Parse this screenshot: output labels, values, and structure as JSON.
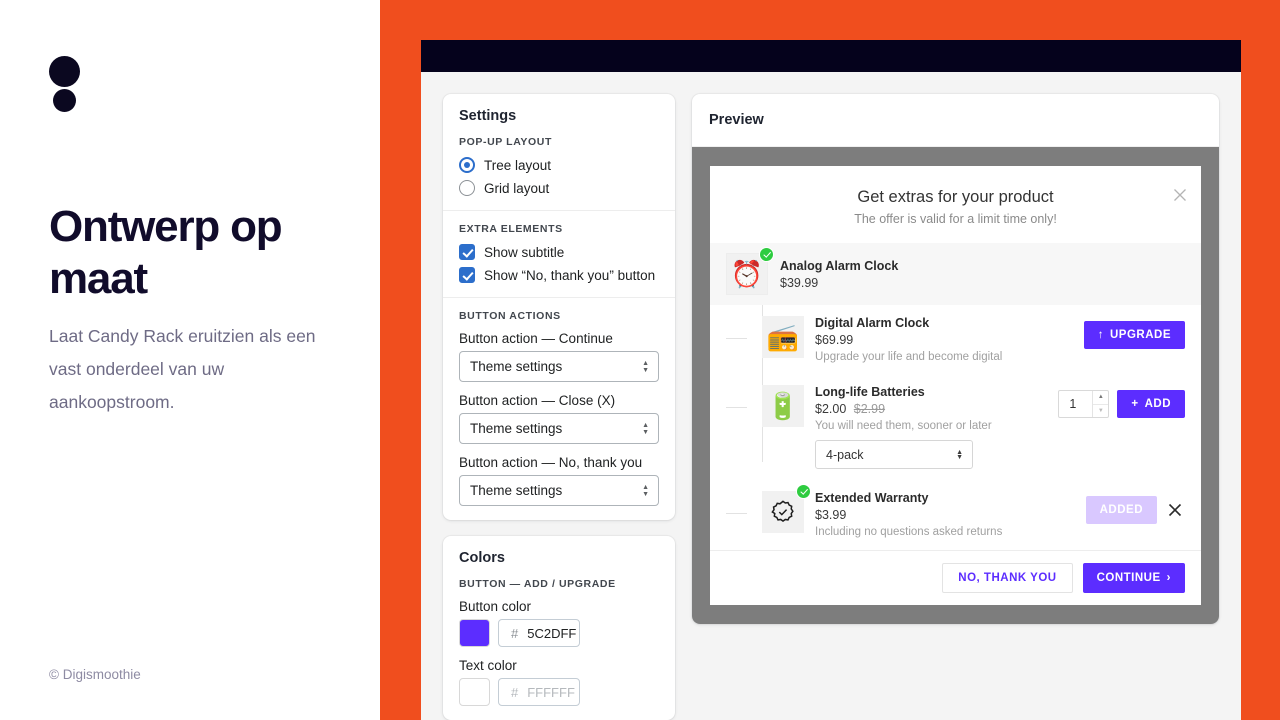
{
  "promo": {
    "logo_icon": "two-dots-logo",
    "title": "Ontwerp op maat",
    "subtitle": "Laat Candy Rack eruitzien als een vast onderdeel van uw aankoopstroom.",
    "copyright": "© Digismoothie"
  },
  "theme": {
    "accent_orange": "#F04E1E",
    "topbar_dark": "#05021C",
    "shopify_blue": "#2C6ECB",
    "brand_purple": "#5C2DFF",
    "added_purple": "#D9C8FF",
    "badge_green": "#2ECC40"
  },
  "settings": {
    "title": "Settings",
    "popup_layout": {
      "label": "POP-UP LAYOUT",
      "options": [
        {
          "label": "Tree layout",
          "selected": true
        },
        {
          "label": "Grid layout",
          "selected": false
        }
      ]
    },
    "extra_elements": {
      "label": "EXTRA ELEMENTS",
      "options": [
        {
          "label": "Show subtitle",
          "checked": true
        },
        {
          "label": "Show “No, thank you” button",
          "checked": true
        }
      ]
    },
    "button_actions": {
      "label": "BUTTON ACTIONS",
      "fields": [
        {
          "label": "Button action — Continue",
          "value": "Theme settings"
        },
        {
          "label": "Button action — Close (X)",
          "value": "Theme settings"
        },
        {
          "label": "Button action — No, thank you",
          "value": "Theme settings"
        }
      ]
    }
  },
  "colors": {
    "title": "Colors",
    "section_label": "BUTTON — ADD / UPGRADE",
    "fields": [
      {
        "label": "Button color",
        "hash": "#",
        "hex": "5C2DFF",
        "swatch": "#5C2DFF",
        "placeholder": false
      },
      {
        "label": "Text color",
        "hash": "#",
        "hex": "FFFFFF",
        "swatch": "#FFFFFF",
        "placeholder": true
      }
    ]
  },
  "preview": {
    "title": "Preview",
    "popup": {
      "title": "Get extras for your product",
      "subtitle": "The offer is valid for a limit time only!",
      "close_icon": "close-icon",
      "parent": {
        "name": "Analog Alarm Clock",
        "price": "$39.99",
        "thumb_icon": "analog-alarm-clock-thumb",
        "badge_icon": "check-badge-icon"
      },
      "children": [
        {
          "name": "Digital Alarm Clock",
          "price": "$69.99",
          "compare_at": "",
          "description": "Upgrade your life and become digital",
          "thumb_icon": "digital-alarm-clock-thumb",
          "badge": false,
          "action": "upgrade",
          "action_label": "UPGRADE",
          "action_icon": "arrow-up-icon"
        },
        {
          "name": "Long-life Batteries",
          "price": "$2.00",
          "compare_at": "$2.99",
          "description": "You will need them, sooner or later",
          "thumb_icon": "batteries-thumb",
          "badge": false,
          "variant": "4-pack",
          "quantity": "1",
          "action": "add",
          "action_label": "ADD",
          "action_icon": "plus-icon"
        },
        {
          "name": "Extended Warranty",
          "price": "$3.99",
          "compare_at": "",
          "description": "Including no questions asked returns",
          "thumb_icon": "warranty-seal-icon",
          "badge": true,
          "action": "added",
          "action_label": "ADDED",
          "remove_icon": "remove-x-icon"
        }
      ],
      "footer": {
        "decline_label": "NO, THANK YOU",
        "continue_label": "CONTINUE",
        "continue_icon": "chevron-right-icon"
      }
    }
  }
}
